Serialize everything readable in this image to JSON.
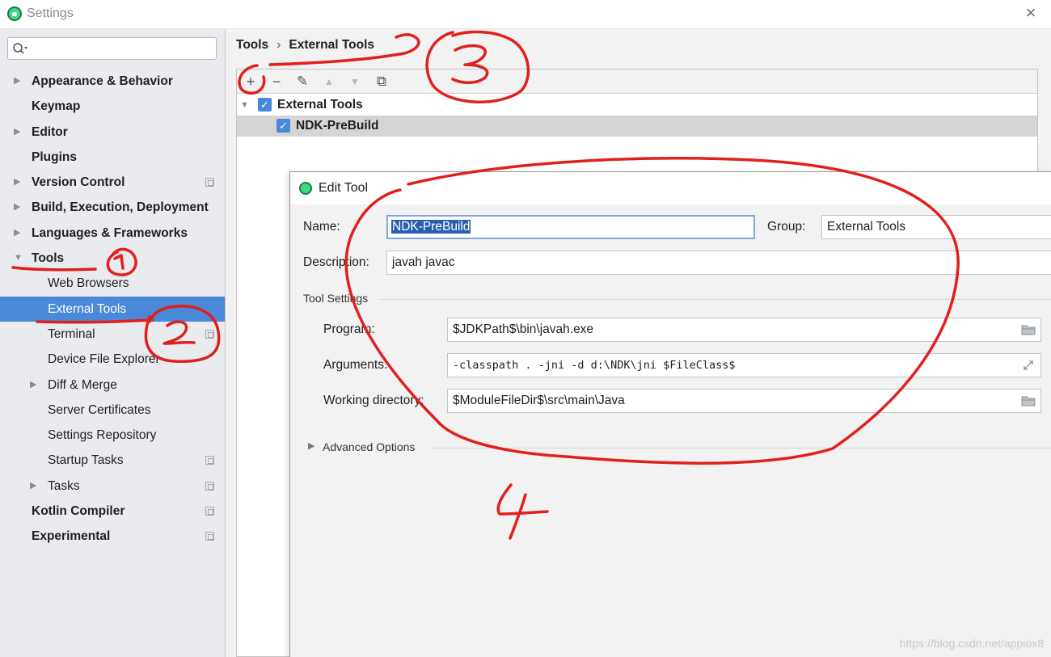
{
  "window": {
    "title": "Settings",
    "close_glyph": "×"
  },
  "search": {
    "placeholder": "",
    "icon": "search-icon"
  },
  "sidebar": {
    "items": [
      {
        "label": "Appearance & Behavior",
        "bold": true,
        "level": 0,
        "arrow": "▶",
        "project": false,
        "selected": false
      },
      {
        "label": "Keymap",
        "bold": true,
        "level": 0,
        "arrow": "",
        "project": false,
        "selected": false
      },
      {
        "label": "Editor",
        "bold": true,
        "level": 0,
        "arrow": "▶",
        "project": false,
        "selected": false
      },
      {
        "label": "Plugins",
        "bold": true,
        "level": 0,
        "arrow": "",
        "project": false,
        "selected": false
      },
      {
        "label": "Version Control",
        "bold": true,
        "level": 0,
        "arrow": "▶",
        "project": true,
        "selected": false
      },
      {
        "label": "Build, Execution, Deployment",
        "bold": true,
        "level": 0,
        "arrow": "▶",
        "project": false,
        "selected": false
      },
      {
        "label": "Languages & Frameworks",
        "bold": true,
        "level": 0,
        "arrow": "▶",
        "project": false,
        "selected": false
      },
      {
        "label": "Tools",
        "bold": true,
        "level": 0,
        "arrow": "▼",
        "project": false,
        "selected": false
      },
      {
        "label": "Web Browsers",
        "bold": false,
        "level": 1,
        "arrow": "",
        "project": false,
        "selected": false
      },
      {
        "label": "External Tools",
        "bold": false,
        "level": 1,
        "arrow": "",
        "project": false,
        "selected": true
      },
      {
        "label": "Terminal",
        "bold": false,
        "level": 1,
        "arrow": "",
        "project": true,
        "selected": false
      },
      {
        "label": "Device File Explorer",
        "bold": false,
        "level": 1,
        "arrow": "",
        "project": false,
        "selected": false
      },
      {
        "label": "Diff & Merge",
        "bold": false,
        "level": 1,
        "arrow": "▶",
        "project": false,
        "selected": false
      },
      {
        "label": "Server Certificates",
        "bold": false,
        "level": 1,
        "arrow": "",
        "project": false,
        "selected": false
      },
      {
        "label": "Settings Repository",
        "bold": false,
        "level": 1,
        "arrow": "",
        "project": false,
        "selected": false
      },
      {
        "label": "Startup Tasks",
        "bold": false,
        "level": 1,
        "arrow": "",
        "project": true,
        "selected": false
      },
      {
        "label": "Tasks",
        "bold": false,
        "level": 1,
        "arrow": "▶",
        "project": true,
        "selected": false
      },
      {
        "label": "Kotlin Compiler",
        "bold": true,
        "level": 0,
        "arrow": "",
        "project": true,
        "selected": false
      },
      {
        "label": "Experimental",
        "bold": true,
        "level": 0,
        "arrow": "",
        "project": true,
        "selected": false
      }
    ]
  },
  "breadcrumb": {
    "parent": "Tools",
    "separator": "›",
    "current": "External Tools"
  },
  "toolbar": {
    "add": "+",
    "remove": "−",
    "edit": "✎",
    "up": "▲",
    "down": "▼",
    "copy": "⧉"
  },
  "tree": {
    "group": {
      "label": "External Tools",
      "checked": "✓",
      "expander": "▼"
    },
    "tool": {
      "label": "NDK-PreBuild",
      "checked": "✓"
    }
  },
  "dialog": {
    "title": "Edit Tool",
    "name_label": "Name:",
    "name_value": "NDK-PreBuild",
    "group_label": "Group:",
    "group_value": "External Tools",
    "description_label": "Description:",
    "description_value": "javah javac",
    "tool_settings_label": "Tool Settings",
    "program_label": "Program:",
    "program_value": "$JDKPath$\\bin\\javah.exe",
    "arguments_label": "Arguments:",
    "arguments_value": "-classpath . -jni -d d:\\NDK\\jni $FileClass$",
    "workdir_label": "Working directory:",
    "workdir_value": "$ModuleFileDir$\\src\\main\\Java",
    "advanced_label": "Advanced Options",
    "advanced_arrow": "▶"
  },
  "annotations": {
    "color": "#e0201c",
    "labels": [
      "1",
      "2",
      "3",
      "4"
    ]
  },
  "watermark": "https://blog.csdn.net/appiox8",
  "colors": {
    "selection": "#4a88d8",
    "sidebar_bg": "#e9ebee",
    "annotation_red": "#e0201c"
  }
}
